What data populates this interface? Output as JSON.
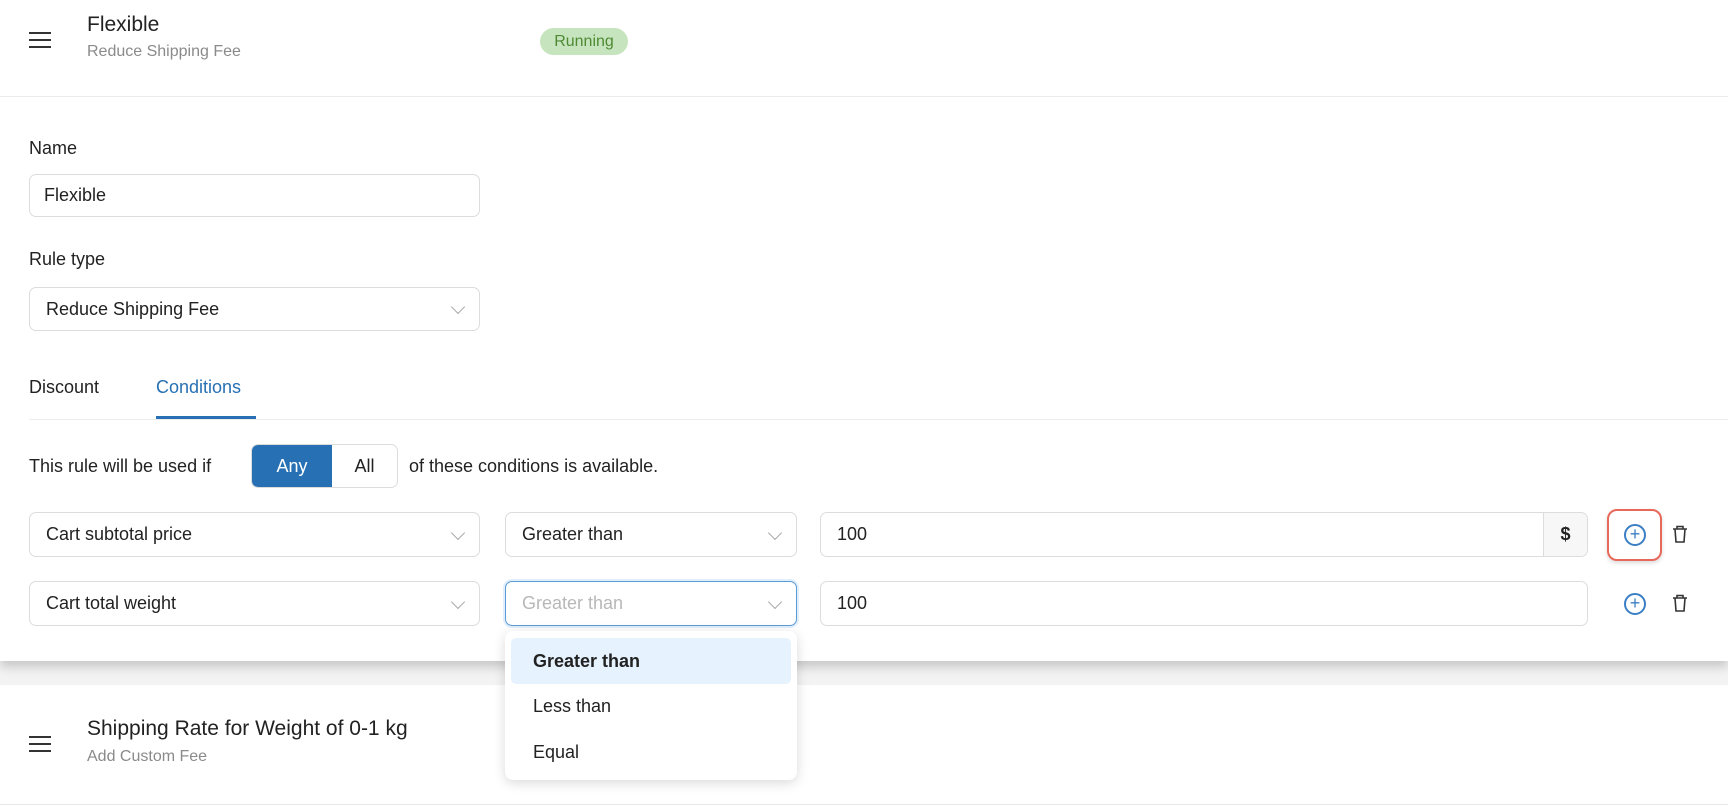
{
  "header": {
    "title": "Flexible",
    "subtitle": "Reduce Shipping Fee",
    "status": "Running"
  },
  "form": {
    "name_label": "Name",
    "name_value": "Flexible",
    "rule_type_label": "Rule type",
    "rule_type_value": "Reduce Shipping Fee",
    "tabs": [
      {
        "label": "Discount",
        "active": false
      },
      {
        "label": "Conditions",
        "active": true
      }
    ],
    "rule_prefix": "This rule will be used if",
    "match_options": [
      "Any",
      "All"
    ],
    "match_selected": "Any",
    "rule_suffix": "of these conditions is available.",
    "conditions": [
      {
        "field": "Cart subtotal price",
        "operator": "Greater than",
        "value": "100",
        "unit": "$"
      },
      {
        "field": "Cart total weight",
        "operator_placeholder": "Greater than",
        "value": "100"
      }
    ],
    "operator_dropdown": {
      "options": [
        "Greater than",
        "Less than",
        "Equal"
      ],
      "highlighted": "Greater than"
    }
  },
  "second_rule": {
    "title": "Shipping Rate for Weight of 0-1 kg",
    "subtitle": "Add Custom Fee"
  },
  "colors": {
    "accent": "#2770b3",
    "badge_bg": "#c6e5bf",
    "badge_text": "#4f8a33",
    "highlight_box": "#e8685a"
  }
}
